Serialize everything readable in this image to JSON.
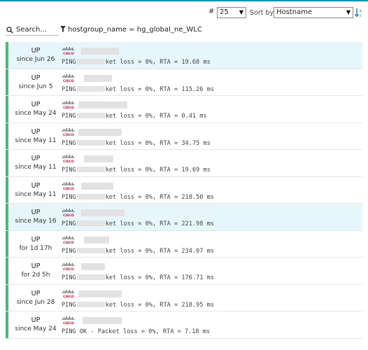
{
  "controls": {
    "limit_label": "#",
    "limit_value": "25",
    "sort_label": "Sort by",
    "sort_value": "Hostname"
  },
  "filter": {
    "search_placeholder": "Search...",
    "filter_text": "hostgroup_name = hg_global_ne_WLC"
  },
  "brand": {
    "logo_text": "CISCO",
    "logo_color": "#c8102e",
    "status_color": "#44bb77",
    "highlight_color": "#e6f6fb"
  },
  "rows": [
    {
      "state": "UP",
      "since": "since Jun 26",
      "head": "PING",
      "tail": "ket loss = 0%, RTA = 19.68 ms",
      "highlight": true
    },
    {
      "state": "UP",
      "since": "since Jun 5",
      "head": "PING",
      "tail": "ket loss = 0%, RTA = 115.26 ms",
      "highlight": false
    },
    {
      "state": "UP",
      "since": "since May 24",
      "head": "PING",
      "tail": "ket loss = 0%, RTA = 0.41 ms",
      "highlight": false
    },
    {
      "state": "UP",
      "since": "since May 11",
      "head": "PING",
      "tail": "ket loss = 0%, RTA = 34.75 ms",
      "highlight": false
    },
    {
      "state": "UP",
      "since": "since May 11",
      "head": "PING",
      "tail": "ket loss = 0%, RTA = 19.69 ms",
      "highlight": false
    },
    {
      "state": "UP",
      "since": "since May 11",
      "head": "PING",
      "tail": "ket loss = 0%, RTA = 218.50 ms",
      "highlight": false
    },
    {
      "state": "UP",
      "since": "since May 16",
      "head": "PING",
      "tail": "ket loss = 0%, RTA = 221.98 ms",
      "highlight": true
    },
    {
      "state": "UP",
      "since": "for 1d 17h",
      "head": "PING",
      "tail": "ket loss = 0%, RTA = 234.07 ms",
      "highlight": false
    },
    {
      "state": "UP",
      "since": "for 2d 5h",
      "head": "PING",
      "tail": "ket loss = 0%, RTA = 176.71 ms",
      "highlight": false
    },
    {
      "state": "UP",
      "since": "since Jun 28",
      "head": "PING",
      "tail": "ket loss = 0%, RTA = 218.95 ms",
      "highlight": false
    },
    {
      "state": "UP",
      "since": "since May 24",
      "head": "PING OK - Packet loss = 0%, RTA = 7.18 ms",
      "tail": "",
      "highlight": false,
      "full": true
    }
  ]
}
